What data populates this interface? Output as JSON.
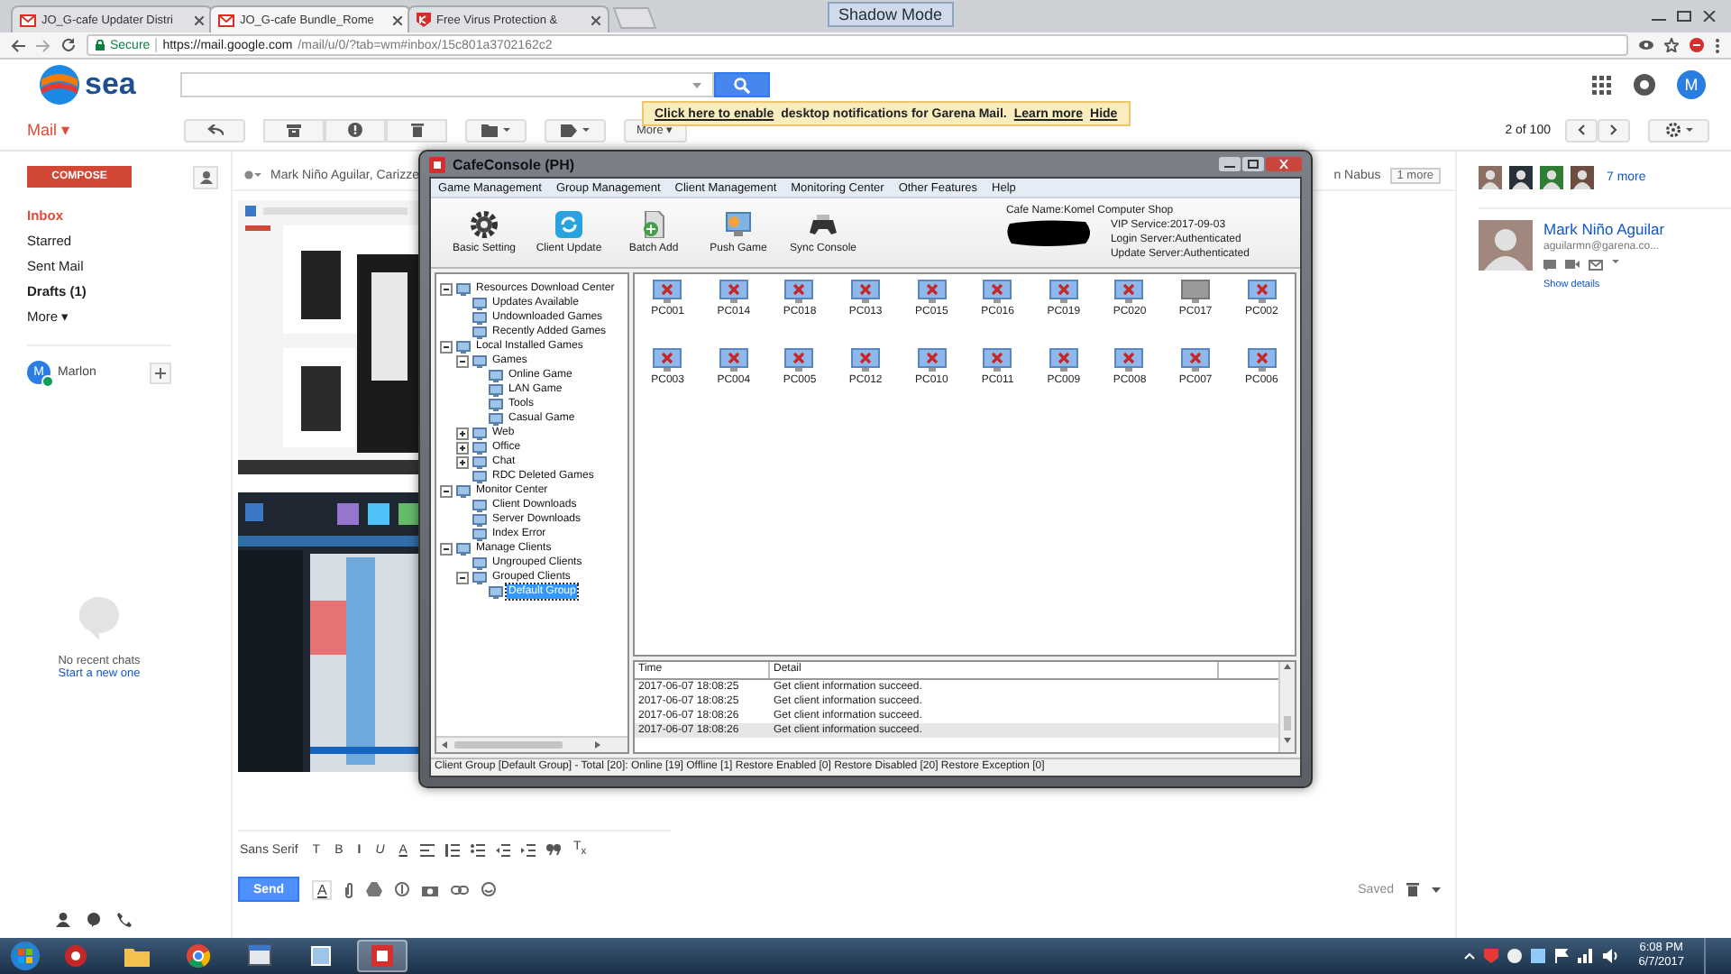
{
  "browser": {
    "tabs": [
      {
        "title": "JO_G-cafe Updater Distri",
        "kind": "mail",
        "selected": false
      },
      {
        "title": "JO_G-cafe Bundle_Rome",
        "kind": "mail",
        "selected": true
      },
      {
        "title": "Free Virus Protection &",
        "kind": "shield",
        "selected": false
      }
    ],
    "mode_label": "Shadow Mode",
    "secure_label": "Secure",
    "url_host": "https://mail.google.com",
    "url_path": "/mail/u/0/?tab=wm#inbox/15c801a3702162c2"
  },
  "gmail": {
    "logo_text": "sea",
    "account_initial": "M",
    "app_menu": "Mail ▾",
    "more_button": "More ▾",
    "notice": {
      "link": "Click here to enable",
      "text": "desktop notifications for Garena Mail.",
      "learn_more": "Learn more",
      "hide": "Hide"
    },
    "pager": "2 of 100",
    "compose_button": "COMPOSE",
    "folders": [
      {
        "label": "Inbox",
        "selected": true,
        "unread": false
      },
      {
        "label": "Starred",
        "selected": false,
        "unread": false
      },
      {
        "label": "Sent Mail",
        "selected": false,
        "unread": false
      },
      {
        "label": "Drafts (1)",
        "selected": false,
        "unread": true
      }
    ],
    "more_folders": "More ▾",
    "chat_user": {
      "initial": "M",
      "name": "Marlon",
      "online": true
    },
    "chat_empty": "No recent chats",
    "chat_start": "Start a new one",
    "thread": {
      "senders": "Mark Niño Aguilar, Carizze",
      "senders_tail": "n Nabus",
      "more_badge": "1 more"
    },
    "people": {
      "more_link": "7 more",
      "contact_name": "Mark Niño Aguilar",
      "contact_email": "aguilarmn@garena.co...",
      "details_link": "Show details"
    },
    "composer": {
      "font": "Sans Serif",
      "format_tools": [
        {
          "kind": "text",
          "label": "T"
        },
        {
          "kind": "text",
          "label": "B"
        },
        {
          "kind": "text",
          "label": "I"
        },
        {
          "kind": "text",
          "label": "U"
        },
        {
          "kind": "text",
          "label": "A"
        },
        {
          "kind": "align"
        },
        {
          "kind": "numbered"
        },
        {
          "kind": "bulleted"
        },
        {
          "kind": "outdent"
        },
        {
          "kind": "indent"
        },
        {
          "kind": "quote"
        },
        {
          "kind": "text",
          "label": "T$_{x}$"
        }
      ],
      "send_button": "Send",
      "format_toggle": "A",
      "saved_label": "Saved"
    }
  },
  "console": {
    "title": "CafeConsole (PH)",
    "menu": [
      "Game Management",
      "Group Management",
      "Client Management",
      "Monitoring Center",
      "Other Features",
      "Help"
    ],
    "tools": [
      {
        "kind": "gear",
        "label": "Basic Setting"
      },
      {
        "kind": "refresh",
        "label": "Client Update"
      },
      {
        "kind": "add",
        "label": "Batch Add"
      },
      {
        "kind": "push",
        "label": "Push Game"
      },
      {
        "kind": "gamepad",
        "label": "Sync Console"
      }
    ],
    "info": {
      "cafe_name": "Cafe Name:Komel Computer Shop",
      "lines": [
        "VIP Service:2017-09-03",
        "Login Server:Authenticated",
        "Update Server:Authenticated"
      ]
    },
    "tree": [
      {
        "label": "Resources Download Center",
        "selected": false,
        "expanded": true,
        "children": [
          {
            "label": "Updates Available",
            "selected": false
          },
          {
            "label": "Undownloaded Games",
            "selected": false
          },
          {
            "label": "Recently Added Games",
            "selected": false
          }
        ]
      },
      {
        "label": "Local Installed Games",
        "selected": false,
        "expanded": true,
        "children": [
          {
            "label": "Games",
            "selected": false,
            "expanded": true,
            "children": [
              {
                "label": "Online Game",
                "selected": false
              },
              {
                "label": "LAN Game",
                "selected": false
              },
              {
                "label": "Tools",
                "selected": false
              },
              {
                "label": "Casual Game",
                "selected": false
              }
            ]
          },
          {
            "label": "Web",
            "selected": false,
            "expanded": false
          },
          {
            "label": "Office",
            "selected": false,
            "expanded": false
          },
          {
            "label": "Chat",
            "selected": false,
            "expanded": false
          },
          {
            "label": "RDC Deleted Games",
            "selected": false
          }
        ]
      },
      {
        "label": "Monitor Center",
        "selected": false,
        "expanded": true,
        "children": [
          {
            "label": "Client Downloads",
            "selected": false
          },
          {
            "label": "Server Downloads",
            "selected": false
          },
          {
            "label": "Index Error",
            "selected": false
          }
        ]
      },
      {
        "label": "Manage Clients",
        "selected": false,
        "expanded": true,
        "children": [
          {
            "label": "Ungrouped Clients",
            "selected": false
          },
          {
            "label": "Grouped Clients",
            "selected": false,
            "expanded": true,
            "children": [
              {
                "label": "Default Group",
                "selected": true
              }
            ]
          }
        ]
      }
    ],
    "clients": [
      {
        "name": "PC001",
        "offline": false
      },
      {
        "name": "PC014",
        "offline": false
      },
      {
        "name": "PC018",
        "offline": false
      },
      {
        "name": "PC013",
        "offline": false
      },
      {
        "name": "PC015",
        "offline": false
      },
      {
        "name": "PC016",
        "offline": false
      },
      {
        "name": "PC019",
        "offline": false
      },
      {
        "name": "PC020",
        "offline": false
      },
      {
        "name": "PC017",
        "offline": true
      },
      {
        "name": "PC002",
        "offline": false
      },
      {
        "name": "PC003",
        "offline": false
      },
      {
        "name": "PC004",
        "offline": false
      },
      {
        "name": "PC005",
        "offline": false
      },
      {
        "name": "PC012",
        "offline": false
      },
      {
        "name": "PC010",
        "offline": false
      },
      {
        "name": "PC011",
        "offline": false
      },
      {
        "name": "PC009",
        "offline": false
      },
      {
        "name": "PC008",
        "offline": false
      },
      {
        "name": "PC007",
        "offline": false
      },
      {
        "name": "PC006",
        "offline": false
      }
    ],
    "log_columns": [
      "Time",
      "Detail"
    ],
    "log": [
      {
        "time": "2017-06-07 18:08:25",
        "detail": "Get client information succeed.",
        "selected": false
      },
      {
        "time": "2017-06-07 18:08:25",
        "detail": "Get client information succeed.",
        "selected": false
      },
      {
        "time": "2017-06-07 18:08:26",
        "detail": "Get client information succeed.",
        "selected": false
      },
      {
        "time": "2017-06-07 18:08:26",
        "detail": "Get client information succeed.",
        "selected": true
      }
    ],
    "status": "Client Group [Default Group] - Total [20]: Online [19] Offline [1] Restore Enabled [0] Restore Disabled [20] Restore Exception [0]"
  },
  "taskbar": {
    "time": "6:08 PM",
    "date": "6/7/2017"
  }
}
